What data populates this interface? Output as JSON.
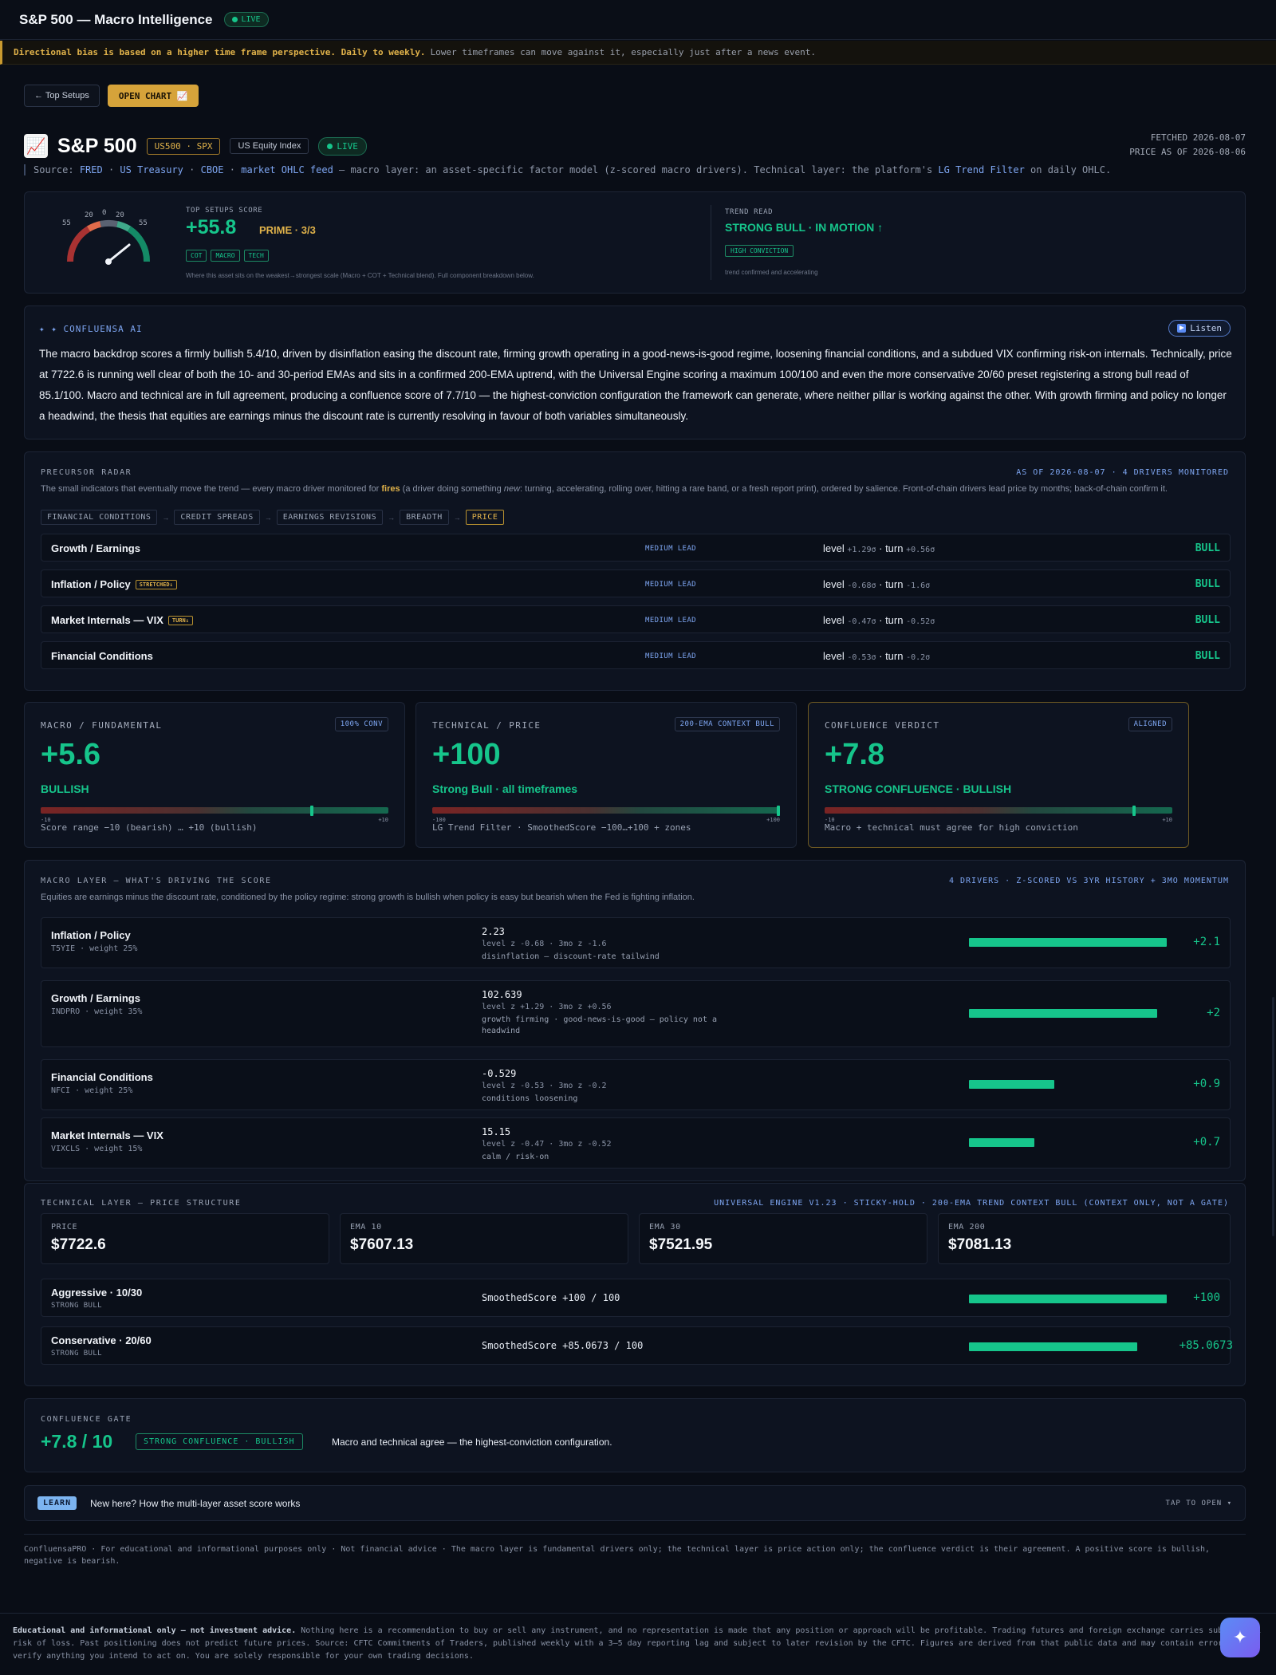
{
  "topbar": {
    "title": "S&P 500 — Macro Intelligence",
    "live": "LIVE"
  },
  "notice": {
    "bold": "Directional bias is based on a higher time frame perspective. Daily to weekly.",
    "rest": "Lower timeframes can move against it, especially just after a news event."
  },
  "nav": {
    "back": "← Top Setups",
    "open_chart": "OPEN CHART 📈"
  },
  "asset": {
    "emoji": "📈",
    "name": "S&P 500",
    "ticker": "US500 · SPX",
    "class": "US Equity Index",
    "live": "LIVE",
    "fetched": "FETCHED 2026-08-07",
    "price_asof": "PRICE AS OF 2026-08-06"
  },
  "source": {
    "prefix": "Source:",
    "fred": "FRED",
    "sep1": "·",
    "treasury": "US Treasury",
    "sep2": "·",
    "cboe": "CBOE",
    "sep3": "·",
    "ohlc": "market OHLC feed",
    "middle": "— macro layer: an asset-specific factor model (z-scored macro drivers). Technical layer: the platform's",
    "lg": "LG Trend Filter",
    "suffix": "on daily OHLC."
  },
  "score": {
    "gauge_ticks": [
      "55",
      "20",
      "0",
      "20",
      "55"
    ],
    "label": "TOP SETUPS SCORE",
    "value": "+55.8",
    "value_num": 55.8,
    "prime": "PRIME · 3/3",
    "tags": [
      "COT",
      "MACRO",
      "TECH"
    ],
    "note": "Where this asset sits on the weakest→strongest scale (Macro + COT + Technical blend). Full component breakdown below.",
    "trend_label": "TREND READ",
    "trend_text": "STRONG BULL · IN MOTION ↑",
    "conviction": "HIGH CONVICTION",
    "trend_note": "trend confirmed and accelerating"
  },
  "ai": {
    "title": "✦ ✦ CONFLUENSA AI",
    "listen": "Listen",
    "text": "The macro backdrop scores a firmly bullish 5.4/10, driven by disinflation easing the discount rate, firming growth operating in a good-news-is-good regime, loosening financial conditions, and a subdued VIX confirming risk-on internals. Technically, price at 7722.6 is running well clear of both the 10- and 30-period EMAs and sits in a confirmed 200-EMA uptrend, with the Universal Engine scoring a maximum 100/100 and even the more conservative 20/60 preset registering a strong bull read of 85.1/100. Macro and technical are in full agreement, producing a confluence score of 7.7/10 — the highest-conviction configuration the framework can generate, where neither pillar is working against the other. With growth firming and policy no longer a headwind, the thesis that equities are earnings minus the discount rate is currently resolving in favour of both variables simultaneously."
  },
  "radar": {
    "title": "PRECURSOR RADAR",
    "asof": "AS OF 2026-08-07 · 4 DRIVERS MONITORED",
    "desc_a": "The small indicators that eventually move the trend — every macro driver monitored for",
    "desc_fires": "fires",
    "desc_b": "(a driver doing something",
    "desc_new": "new",
    "desc_c": ": turning, accelerating, rolling over, hitting a rare band, or a fresh report print), ordered by salience. Front-of-chain drivers lead price by months; back-of-chain confirm it.",
    "chain": [
      "FINANCIAL CONDITIONS",
      "CREDIT SPREADS",
      "EARNINGS REVISIONS",
      "BREADTH",
      "PRICE"
    ],
    "rows": [
      {
        "name": "Growth / Earnings",
        "flag": "",
        "lead": "MEDIUM LEAD",
        "level": "+1.29σ",
        "turn": "+0.56σ",
        "bias": "BULL"
      },
      {
        "name": "Inflation / Policy",
        "flag": "STRETCHED↓",
        "lead": "MEDIUM LEAD",
        "level": "-0.68σ",
        "turn": "-1.6σ",
        "bias": "BULL"
      },
      {
        "name": "Market Internals — VIX",
        "flag": "TURN↓",
        "lead": "MEDIUM LEAD",
        "level": "-0.47σ",
        "turn": "-0.52σ",
        "bias": "BULL"
      },
      {
        "name": "Financial Conditions",
        "flag": "",
        "lead": "MEDIUM LEAD",
        "level": "-0.53σ",
        "turn": "-0.2σ",
        "bias": "BULL"
      }
    ],
    "level_word": "level",
    "turn_word": "turn"
  },
  "cards": [
    {
      "head": "MACRO / FUNDAMENTAL",
      "badge": "100% CONV",
      "value": "+5.6",
      "label": "BULLISH",
      "position": 0.78,
      "min": "-10",
      "max": "+10",
      "caption": "Score range −10 (bearish) … +10 (bullish)"
    },
    {
      "head": "TECHNICAL / PRICE",
      "badge": "200-EMA CONTEXT BULL",
      "value": "+100",
      "label": "Strong Bull · all timeframes",
      "position": 1.0,
      "min": "-100",
      "max": "+100",
      "caption": "LG Trend Filter · SmoothedScore −100…+100 + zones"
    },
    {
      "head": "CONFLUENCE VERDICT",
      "badge": "ALIGNED",
      "value": "+7.8",
      "label": "STRONG CONFLUENCE · BULLISH",
      "position": 0.89,
      "min": "-10",
      "max": "+10",
      "caption": "Macro + technical must agree for high conviction"
    }
  ],
  "macro": {
    "title": "MACRO LAYER — WHAT'S DRIVING THE SCORE",
    "right": "4 DRIVERS · Z-SCORED VS 3YR HISTORY + 3MO MOMENTUM",
    "desc": "Equities are earnings minus the discount rate, conditioned by the policy regime: strong growth is bullish when policy is easy but bearish when the Fed is fighting inflation.",
    "rows": [
      {
        "name": "Inflation / Policy",
        "sub": "T5YIE · weight 25%",
        "value": "2.23",
        "z": "level z -0.68 · 3mo z -1.6",
        "note": "disinflation — discount-rate tailwind",
        "score": "+2.1",
        "score_num": 2.1
      },
      {
        "name": "Growth / Earnings",
        "sub": "INDPRO · weight 35%",
        "value": "102.639",
        "z": "level z +1.29 · 3mo z +0.56",
        "note": "growth firming · good-news-is-good — policy not a headwind",
        "score": "+2",
        "score_num": 2.0
      },
      {
        "name": "Financial Conditions",
        "sub": "NFCI · weight 25%",
        "value": "-0.529",
        "z": "level z -0.53 · 3mo z -0.2",
        "note": "conditions loosening",
        "score": "+0.9",
        "score_num": 0.9
      },
      {
        "name": "Market Internals — VIX",
        "sub": "VIXCLS · weight 15%",
        "value": "15.15",
        "z": "level z -0.47 · 3mo z -0.52",
        "note": "calm / risk-on",
        "score": "+0.7",
        "score_num": 0.7
      }
    ]
  },
  "tech": {
    "title": "TECHNICAL LAYER — PRICE STRUCTURE",
    "right": "UNIVERSAL ENGINE V1.23 · STICKY-HOLD · 200-EMA TREND CONTEXT BULL (CONTEXT ONLY, NOT A GATE)",
    "prices": [
      {
        "k": "PRICE",
        "v": "$7722.6"
      },
      {
        "k": "EMA 10",
        "v": "$7607.13"
      },
      {
        "k": "EMA 30",
        "v": "$7521.95"
      },
      {
        "k": "EMA 200",
        "v": "$7081.13"
      }
    ],
    "rows": [
      {
        "name": "Aggressive · 10/30",
        "sub": "STRONG BULL",
        "ss": "SmoothedScore +100 / 100",
        "score": "+100",
        "score_num": 100
      },
      {
        "name": "Conservative · 20/60",
        "sub": "STRONG BULL",
        "ss": "SmoothedScore +85.0673 / 100",
        "score": "+85.0673",
        "score_num": 85.0673
      }
    ]
  },
  "gate": {
    "title": "CONFLUENCE GATE",
    "score": "+7.8 / 10",
    "tag": "STRONG CONFLUENCE · BULLISH",
    "desc": "Macro and technical agree — the highest-conviction configuration."
  },
  "learn": {
    "tag": "LEARN",
    "text": "New here? How the multi-layer asset score works",
    "open": "TAP TO OPEN ▾"
  },
  "footer": "ConfluensaPRO · For educational and informational purposes only · Not financial advice · The macro layer is fundamental drivers only; the technical layer is price action only; the confluence verdict is their agreement. A positive score is bullish, negative is bearish.",
  "disclaimer": {
    "bold": "Educational and informational only — not investment advice.",
    "text": "Nothing here is a recommendation to buy or sell any instrument, and no representation is made that any position or approach will be profitable. Trading futures and foreign exchange carries substantial risk of loss. Past positioning does not predict future prices. Source: CFTC Commitments of Traders, published weekly with a 3–5 day reporting lag and subject to later revision by the CFTC. Figures are derived from that public data and may contain errors — verify anything you intend to act on. You are solely responsible for your own trading decisions."
  },
  "colors": {
    "accent_green": "#16c58b",
    "accent_gold": "#e0b24a",
    "accent_blue": "#7ea6f2",
    "background": "#090d16"
  },
  "icons": {
    "fab": "sparkle-icon",
    "listen": "play-icon",
    "gauge": "gauge-icon"
  }
}
